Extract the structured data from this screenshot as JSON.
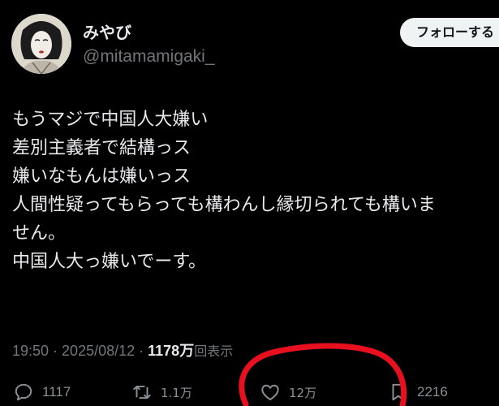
{
  "user": {
    "display_name": "みやび",
    "handle": "@mitamamigaki_"
  },
  "follow_button": {
    "label": "フォローする"
  },
  "tweet": {
    "lines": [
      "もうマジで中国人大嫌い",
      "差別主義者で結構っス",
      "嫌いなもんは嫌いっス",
      "人間性疑ってもらっても構わんし縁切られても構いま",
      "せん。",
      "中国人大っ嫌いでーす。"
    ]
  },
  "meta": {
    "time": "19:50",
    "separator": "·",
    "date": "2025/08/12",
    "views_count": "1178万",
    "views_label": "回表示"
  },
  "actions": {
    "reply": {
      "icon": "reply-icon",
      "count": "1117"
    },
    "retweet": {
      "icon": "retweet-icon",
      "count": "1.1万"
    },
    "like": {
      "icon": "heart-icon",
      "count": "12万"
    },
    "bookmark": {
      "icon": "bookmark-icon",
      "count": "2216"
    }
  },
  "annotation": {
    "color": "#e8101e"
  }
}
